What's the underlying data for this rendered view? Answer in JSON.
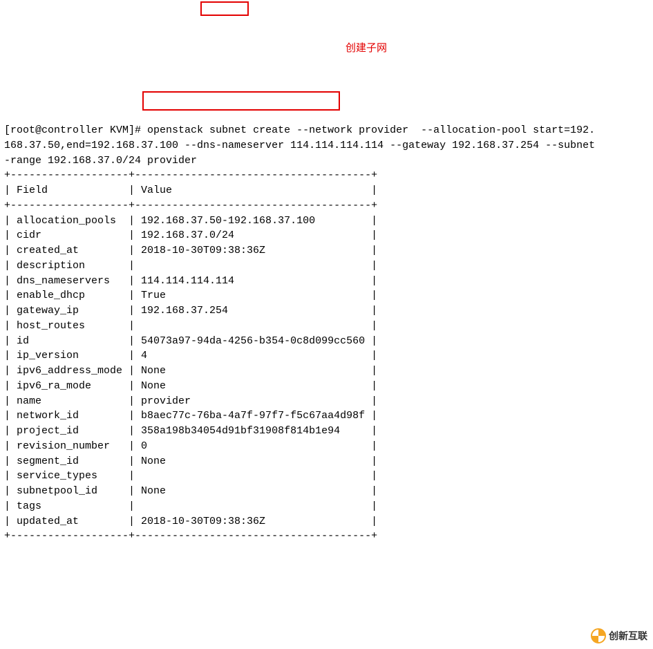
{
  "prompt": "[root@controller KVM]# ",
  "command": "openstack subnet create --network provider  --allocation-pool start=192.\n168.37.50,end=192.168.37.100 --dns-nameserver 114.114.114.114 --gateway 192.168.37.254 --subnet\n-range 192.168.37.0/24 provider",
  "annotation": "创建子网",
  "header": {
    "field": "Field",
    "value": "Value"
  },
  "rows": [
    {
      "field": "allocation_pools",
      "value": "192.168.37.50-192.168.37.100"
    },
    {
      "field": "cidr",
      "value": "192.168.37.0/24"
    },
    {
      "field": "created_at",
      "value": "2018-10-30T09:38:36Z"
    },
    {
      "field": "description",
      "value": ""
    },
    {
      "field": "dns_nameservers",
      "value": "114.114.114.114"
    },
    {
      "field": "enable_dhcp",
      "value": "True"
    },
    {
      "field": "gateway_ip",
      "value": "192.168.37.254"
    },
    {
      "field": "host_routes",
      "value": ""
    },
    {
      "field": "id",
      "value": "54073a97-94da-4256-b354-0c8d099cc560"
    },
    {
      "field": "ip_version",
      "value": "4"
    },
    {
      "field": "ipv6_address_mode",
      "value": "None"
    },
    {
      "field": "ipv6_ra_mode",
      "value": "None"
    },
    {
      "field": "name",
      "value": "provider"
    },
    {
      "field": "network_id",
      "value": "b8aec77c-76ba-4a7f-97f7-f5c67aa4d98f"
    },
    {
      "field": "project_id",
      "value": "358a198b34054d91bf31908f814b1e94"
    },
    {
      "field": "revision_number",
      "value": "0"
    },
    {
      "field": "segment_id",
      "value": "None"
    },
    {
      "field": "service_types",
      "value": ""
    },
    {
      "field": "subnetpool_id",
      "value": "None"
    },
    {
      "field": "tags",
      "value": ""
    },
    {
      "field": "updated_at",
      "value": "2018-10-30T09:38:36Z"
    }
  ],
  "watermark": "创新互联"
}
